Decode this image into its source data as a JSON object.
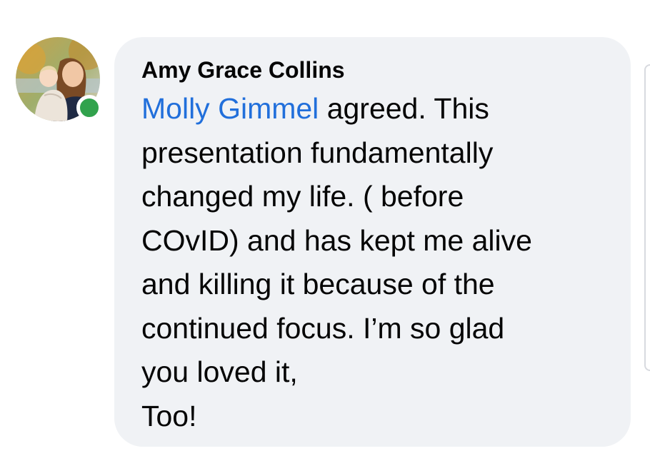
{
  "comment": {
    "author": "Amy Grace Collins",
    "mention": "Molly Gimmel",
    "text_line_1": " agreed. This",
    "text_lines": [
      "presentation fundamentally",
      "changed my life. ( before",
      "COvID) and has kept me alive",
      "and killing it because of the",
      "continued focus. I’m so glad",
      "you loved it,",
      "Too!"
    ]
  },
  "presence": {
    "status": "online",
    "color": "#31a24c"
  },
  "colors": {
    "bubble": "#f0f2f5",
    "mention": "#216fdb",
    "text": "#050505"
  }
}
